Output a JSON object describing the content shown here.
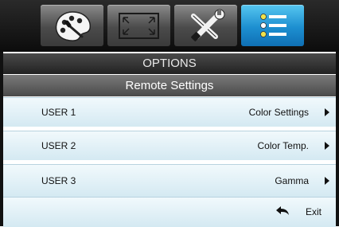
{
  "tabs": [
    {
      "icon": "palette-icon",
      "active": false
    },
    {
      "icon": "display-aspect-icon",
      "active": false
    },
    {
      "icon": "tools-icon",
      "active": false
    },
    {
      "icon": "options-list-icon",
      "active": true
    }
  ],
  "header": {
    "title": "OPTIONS",
    "subtitle": "Remote Settings"
  },
  "rows": [
    {
      "label": "USER 1",
      "value": "Color Settings"
    },
    {
      "label": "USER 2",
      "value": "Color Temp."
    },
    {
      "label": "USER 3",
      "value": "Gamma"
    }
  ],
  "exit": {
    "label": "Exit",
    "icon": "return-arrow-icon"
  }
}
